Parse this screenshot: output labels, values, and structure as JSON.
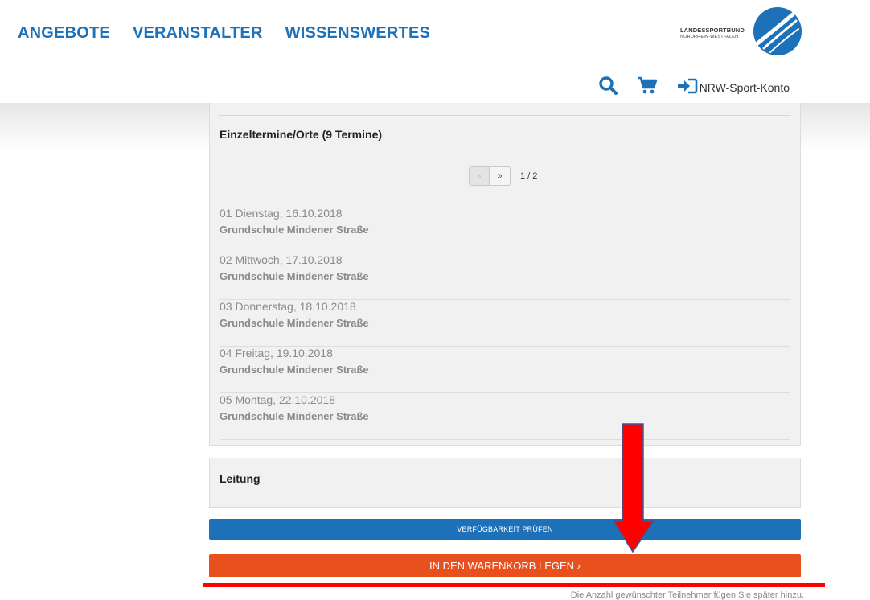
{
  "nav": {
    "items": [
      {
        "label": "ANGEBOTE"
      },
      {
        "label": "VERANSTALTER"
      },
      {
        "label": "WISSENSWERTES"
      }
    ]
  },
  "logo": {
    "line1": "LANDESSPORTBUND",
    "line2": "NORDRHEIN-WESTFALEN"
  },
  "utility": {
    "search_icon": "search-icon",
    "cart_icon": "cart-icon",
    "login_icon": "sign-in-icon",
    "account_label": "NRW-Sport-Konto"
  },
  "termine": {
    "heading": "Einzeltermine/Orte (9 Termine)",
    "pager": {
      "prev": "«",
      "next": "»",
      "page_info": "1 / 2"
    },
    "items": [
      {
        "date": "01 Dienstag, 16.10.2018",
        "place": "Grundschule Mindener Straße"
      },
      {
        "date": "02 Mittwoch, 17.10.2018",
        "place": "Grundschule Mindener Straße"
      },
      {
        "date": "03 Donnerstag, 18.10.2018",
        "place": "Grundschule Mindener Straße"
      },
      {
        "date": "04 Freitag, 19.10.2018",
        "place": "Grundschule Mindener Straße"
      },
      {
        "date": "05 Montag, 22.10.2018",
        "place": "Grundschule Mindener Straße"
      }
    ]
  },
  "leitung": {
    "heading": "Leitung"
  },
  "actions": {
    "check_label": "Verfügbarkeit prüfen",
    "cart_label": "IN DEN WARENKORB LEGEN ›"
  },
  "hint": "Die Anzahl gewünschter Teilnehmer fügen Sie später hinzu.",
  "colors": {
    "brand_blue": "#1d71b8",
    "cart_orange": "#e8501e",
    "annotation_red": "#ff0000"
  }
}
